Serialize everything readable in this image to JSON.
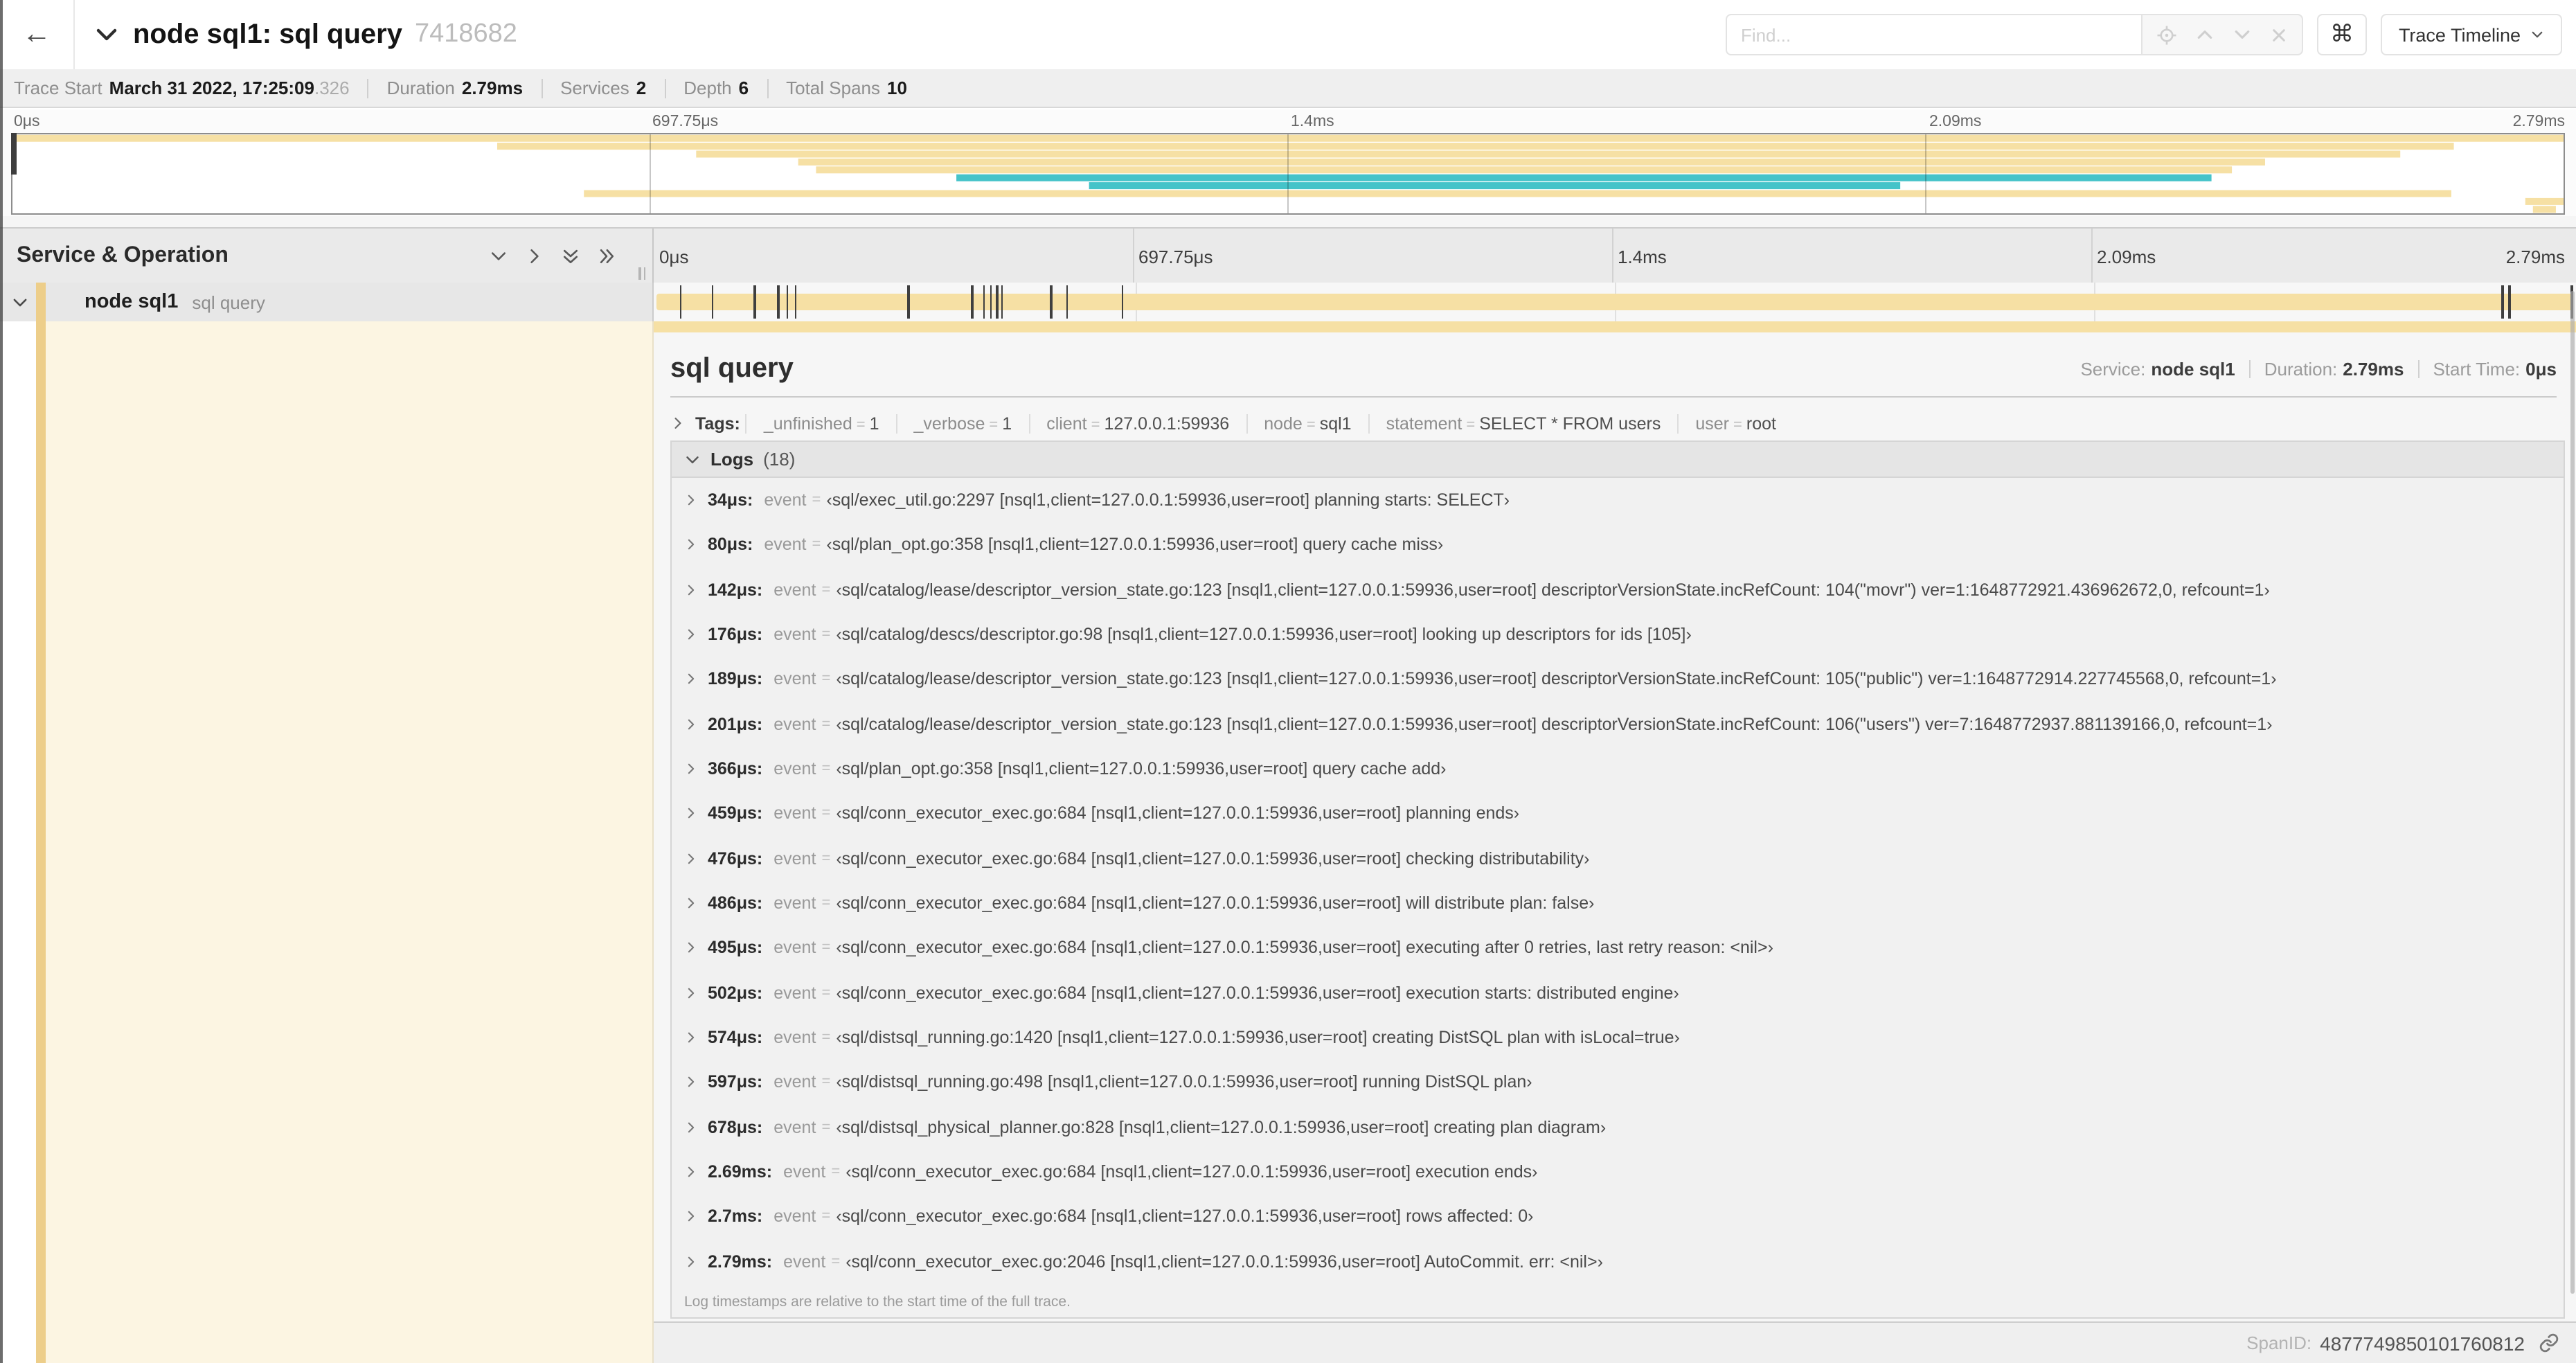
{
  "header": {
    "back_icon": "←",
    "title": "node sql1: sql query",
    "trace_id": "7418682",
    "find_placeholder": "Find...",
    "cmd_symbol": "⌘",
    "view_selector": "Trace Timeline"
  },
  "summary": {
    "items": [
      {
        "label": "Trace Start",
        "value": "March 31 2022, 17:25:09",
        "suffix": ".326"
      },
      {
        "label": "Duration",
        "value": "2.79ms"
      },
      {
        "label": "Services",
        "value": "2"
      },
      {
        "label": "Depth",
        "value": "6"
      },
      {
        "label": "Total Spans",
        "value": "10"
      }
    ]
  },
  "timeline": {
    "left_header": "Service & Operation",
    "ticks": [
      "0μs",
      "697.75μs",
      "1.4ms",
      "2.09ms",
      "2.79ms"
    ],
    "tick_fractions": [
      0,
      0.25,
      0.5,
      0.75,
      1
    ],
    "duration_us": 2790,
    "row": {
      "service": "node sql1",
      "operation": "sql query"
    },
    "log_marker_times_us": [
      34,
      80,
      142,
      176,
      189,
      201,
      366,
      459,
      476,
      486,
      495,
      502,
      574,
      597,
      678,
      2690,
      2700,
      2790
    ]
  },
  "minimap": {
    "rows": [
      {
        "s": 0.0,
        "e": 1.0,
        "c": "tan"
      },
      {
        "s": 0.19,
        "e": 0.957,
        "c": "tan"
      },
      {
        "s": 0.268,
        "e": 0.936,
        "c": "tan"
      },
      {
        "s": 0.308,
        "e": 0.883,
        "c": "tan"
      },
      {
        "s": 0.315,
        "e": 0.87,
        "c": "tan"
      },
      {
        "s": 0.37,
        "e": 0.862,
        "c": "teal"
      },
      {
        "s": 0.422,
        "e": 0.74,
        "c": "teal"
      },
      {
        "s": 0.224,
        "e": 0.956,
        "c": "tan"
      },
      {
        "s": 0.985,
        "e": 1.0,
        "c": "tan"
      },
      {
        "s": 0.988,
        "e": 0.997,
        "c": "tan"
      }
    ]
  },
  "detail": {
    "title": "sql query",
    "overview": [
      {
        "label": "Service:",
        "value": "node sql1"
      },
      {
        "label": "Duration:",
        "value": "2.79ms"
      },
      {
        "label": "Start Time:",
        "value": "0μs"
      }
    ],
    "tags_label": "Tags:",
    "equals_sign": "=",
    "tags": [
      {
        "key": "_unfinished",
        "value": "1"
      },
      {
        "key": "_verbose",
        "value": "1"
      },
      {
        "key": "client",
        "value": "127.0.0.1:59936"
      },
      {
        "key": "node",
        "value": "sql1"
      },
      {
        "key": "statement",
        "value": "SELECT * FROM users"
      },
      {
        "key": "user",
        "value": "root"
      }
    ],
    "logs_label": "Logs",
    "logs_count": "(18)",
    "logs": [
      {
        "time": "34μs:",
        "key": "event",
        "value": "‹sql/exec_util.go:2297 [nsql1,client=127.0.0.1:59936,user=root] planning starts: SELECT›"
      },
      {
        "time": "80μs:",
        "key": "event",
        "value": "‹sql/plan_opt.go:358 [nsql1,client=127.0.0.1:59936,user=root] query cache miss›"
      },
      {
        "time": "142μs:",
        "key": "event",
        "value": "‹sql/catalog/lease/descriptor_version_state.go:123 [nsql1,client=127.0.0.1:59936,user=root] descriptorVersionState.incRefCount: 104(\"movr\") ver=1:1648772921.436962672,0, refcount=1›"
      },
      {
        "time": "176μs:",
        "key": "event",
        "value": "‹sql/catalog/descs/descriptor.go:98 [nsql1,client=127.0.0.1:59936,user=root] looking up descriptors for ids [105]›"
      },
      {
        "time": "189μs:",
        "key": "event",
        "value": "‹sql/catalog/lease/descriptor_version_state.go:123 [nsql1,client=127.0.0.1:59936,user=root] descriptorVersionState.incRefCount: 105(\"public\") ver=1:1648772914.227745568,0, refcount=1›"
      },
      {
        "time": "201μs:",
        "key": "event",
        "value": "‹sql/catalog/lease/descriptor_version_state.go:123 [nsql1,client=127.0.0.1:59936,user=root] descriptorVersionState.incRefCount: 106(\"users\") ver=7:1648772937.881139166,0, refcount=1›"
      },
      {
        "time": "366μs:",
        "key": "event",
        "value": "‹sql/plan_opt.go:358 [nsql1,client=127.0.0.1:59936,user=root] query cache add›"
      },
      {
        "time": "459μs:",
        "key": "event",
        "value": "‹sql/conn_executor_exec.go:684 [nsql1,client=127.0.0.1:59936,user=root] planning ends›"
      },
      {
        "time": "476μs:",
        "key": "event",
        "value": "‹sql/conn_executor_exec.go:684 [nsql1,client=127.0.0.1:59936,user=root] checking distributability›"
      },
      {
        "time": "486μs:",
        "key": "event",
        "value": "‹sql/conn_executor_exec.go:684 [nsql1,client=127.0.0.1:59936,user=root] will distribute plan: false›"
      },
      {
        "time": "495μs:",
        "key": "event",
        "value": "‹sql/conn_executor_exec.go:684 [nsql1,client=127.0.0.1:59936,user=root] executing after 0 retries, last retry reason: <nil>›"
      },
      {
        "time": "502μs:",
        "key": "event",
        "value": "‹sql/conn_executor_exec.go:684 [nsql1,client=127.0.0.1:59936,user=root] execution starts: distributed engine›"
      },
      {
        "time": "574μs:",
        "key": "event",
        "value": "‹sql/distsql_running.go:1420 [nsql1,client=127.0.0.1:59936,user=root] creating DistSQL plan with isLocal=true›"
      },
      {
        "time": "597μs:",
        "key": "event",
        "value": "‹sql/distsql_running.go:498 [nsql1,client=127.0.0.1:59936,user=root] running DistSQL plan›"
      },
      {
        "time": "678μs:",
        "key": "event",
        "value": "‹sql/distsql_physical_planner.go:828 [nsql1,client=127.0.0.1:59936,user=root] creating plan diagram›"
      },
      {
        "time": "2.69ms:",
        "key": "event",
        "value": "‹sql/conn_executor_exec.go:684 [nsql1,client=127.0.0.1:59936,user=root] execution ends›"
      },
      {
        "time": "2.7ms:",
        "key": "event",
        "value": "‹sql/conn_executor_exec.go:684 [nsql1,client=127.0.0.1:59936,user=root] rows affected: 0›"
      },
      {
        "time": "2.79ms:",
        "key": "event",
        "value": "‹sql/conn_executor_exec.go:2046 [nsql1,client=127.0.0.1:59936,user=root] AutoCommit. err: <nil>›"
      }
    ],
    "logs_note": "Log timestamps are relative to the start time of the full trace.",
    "footer_label": "SpanID:",
    "span_id": "4877749850101760812"
  },
  "colors": {
    "tan": "#F6E0A4",
    "tan_stripe": "#EDCE8A",
    "teal": "#45C3C9",
    "cream": "#FCF5E2"
  }
}
